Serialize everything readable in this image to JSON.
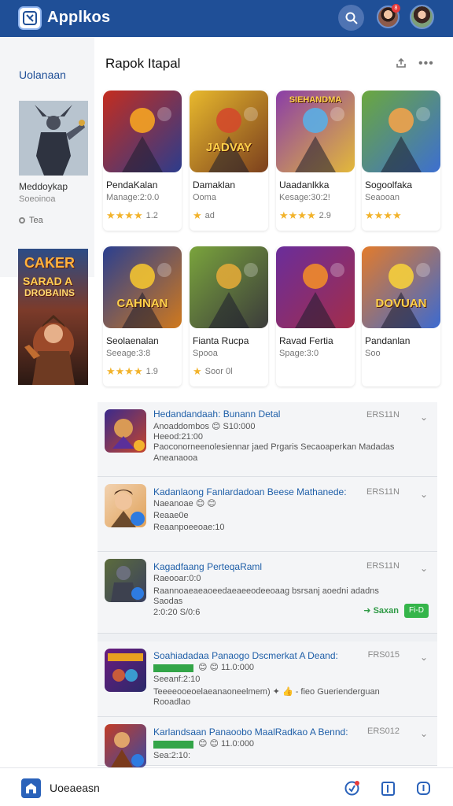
{
  "app": {
    "title": "Applkos"
  },
  "header": {
    "notification_count": "8"
  },
  "sidebar": {
    "title": "Uolanaan",
    "featured": {
      "name": "Meddoykap",
      "sub": "Soeoinoa",
      "meta": "Tea"
    },
    "poster": {
      "line1": "CAKER",
      "line2": "SARAD A",
      "line3": "DROBAINS"
    }
  },
  "main": {
    "title": "Rapok Itapal",
    "cards": [
      {
        "name": "PendaKalan",
        "sub": "Manage:2:0.0",
        "rating_value": "1.2",
        "stars": 4,
        "colors": [
          "#c42d1f",
          "#2c3c8c",
          "#f5a322"
        ]
      },
      {
        "name": "Damaklan",
        "sub": "Ooma",
        "rating_value": "ad",
        "stars": 1,
        "colors": [
          "#e8b92d",
          "#7b3f1d",
          "#d34a2b"
        ]
      },
      {
        "name": "Uaadanlkka",
        "sub": "Kesage:30:2!",
        "rating_value": "2.9",
        "stars": 4,
        "colors": [
          "#8a3da8",
          "#e3b93a",
          "#5aaee6"
        ]
      },
      {
        "name": "Sogoolfaka",
        "sub": "Seaooan",
        "rating_value": "",
        "stars": 4,
        "colors": [
          "#6ba83d",
          "#3d6fd0",
          "#f0a24b"
        ]
      },
      {
        "name": "Seolaenalan",
        "sub": "Seeage:3:8",
        "rating_value": "1.9",
        "stars": 4,
        "colors": [
          "#2a3f90",
          "#d0791d",
          "#f2c331"
        ]
      },
      {
        "name": "Fianta Rucpa",
        "sub": "Spooa",
        "rating_value": "Soor 0l",
        "stars": 1,
        "colors": [
          "#7aa43c",
          "#3b3b3b",
          "#e0a838"
        ]
      },
      {
        "name": "Ravad Fertia",
        "sub": "Spage:3:0",
        "rating_value": "",
        "stars": 0,
        "colors": [
          "#6a2d9b",
          "#a32d4a",
          "#f08b2a"
        ]
      },
      {
        "name": "Pandanlan",
        "sub": "Soo",
        "rating_value": "",
        "stars": 0,
        "colors": [
          "#e37b2b",
          "#3c6ad0",
          "#f5cf3c"
        ]
      }
    ],
    "card_titles": [
      "",
      "JADVAY",
      "SIEHANDMA",
      "",
      "CAHNAN",
      "",
      "",
      "DOVUAN"
    ]
  },
  "feed": [
    {
      "title": "Hedandandaah: Bunann Detal",
      "line1": "Anoaddombos 😊 S10:000",
      "line2": "Heeod:21:00",
      "line3": "Paoconorneenolesiennar jaed Prgaris Secaoaperkan Madadas",
      "line4": "Aneanaooa",
      "code": "ERS11N"
    },
    {
      "title": "Kadanlaong Fanlardadoan Beese Mathanede:",
      "line1": "Naeanoae 😊 😊",
      "line2": "Reaae0e",
      "line3": "Reaanpoeeoae:10",
      "code": "ERS11N"
    },
    {
      "title": "Kagadfaang PerteqaRaml",
      "line1": "Raeooar:0:0",
      "line2": "Raannoaeaeaoeedaeaeeodeeoaag bsrsanj aoedni adadns",
      "line3": "Saodas",
      "line4": "2:0:20 S/0:6",
      "code": "ERS11N",
      "saved_label": "Saxan",
      "button": "Fi-D"
    },
    {
      "title": "Soahiadadaa Panaogo Dscmerkat A Deand:",
      "line1": "😊 😊 11.0:000",
      "line2": "Seeanf:2:10",
      "line3": "Teeeeooeoelaeanaoneelmem) ✦ 👍 - fieo Guerienderguan",
      "line4": "Rooadlao",
      "code": "FRS015"
    },
    {
      "title": "Karlandsaan Panaoobo MaalRadkao A Bennd:",
      "line1": "😊 😊 11.0:000",
      "line2": "Sea:2:10:",
      "code": "ERS012"
    }
  ],
  "bottom": {
    "label": "Uoeaeasn"
  }
}
